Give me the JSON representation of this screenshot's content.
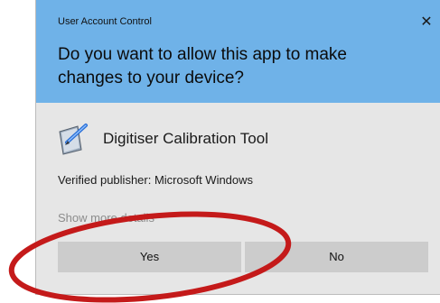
{
  "dialog": {
    "window_title": "User Account Control",
    "question": "Do you want to allow this app to make changes to your device?",
    "app_name": "Digitiser Calibration Tool",
    "publisher": "Verified publisher: Microsoft Windows",
    "details_link": "Show more details",
    "yes_label": "Yes",
    "no_label": "No",
    "close_glyph": "✕",
    "app_icon": "pen-tablet-icon"
  },
  "colors": {
    "header_bg": "#6fb2e8",
    "body_bg": "#e6e6e6",
    "button_bg": "#cccccc",
    "highlight_ellipse": "#c41a1a"
  }
}
